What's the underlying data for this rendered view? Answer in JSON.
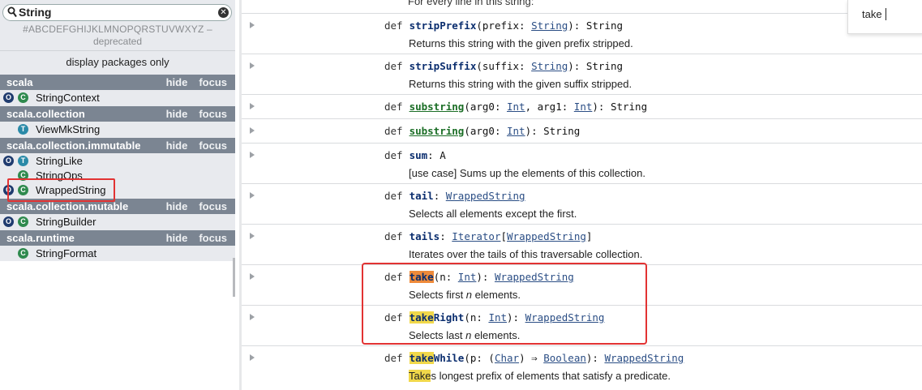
{
  "sidebar": {
    "search_value": "String",
    "letters": "#ABCDEFGHIJKLMNOPQRSTUVWXYZ –",
    "deprecated": "deprecated",
    "display_packages": "display packages only",
    "hide_label": "hide",
    "focus_label": "focus",
    "packages": [
      {
        "name": "scala",
        "entries": [
          {
            "label": "StringContext",
            "icons": [
              "object-icon",
              "class-icon"
            ]
          }
        ]
      },
      {
        "name": "scala.collection",
        "entries": [
          {
            "label": "ViewMkString",
            "icons": [
              "trait-icon"
            ]
          }
        ]
      },
      {
        "name": "scala.collection.immutable",
        "entries": [
          {
            "label": "StringLike",
            "icons": [
              "object-icon",
              "trait-icon"
            ]
          },
          {
            "label": "StringOps",
            "icons": [
              "class-icon"
            ]
          },
          {
            "label": "WrappedString",
            "icons": [
              "object-icon",
              "class-icon"
            ]
          }
        ]
      },
      {
        "name": "scala.collection.mutable",
        "entries": [
          {
            "label": "StringBuilder",
            "icons": [
              "object-icon",
              "class-icon"
            ]
          }
        ]
      },
      {
        "name": "scala.runtime",
        "entries": [
          {
            "label": "StringFormat",
            "icons": [
              "class-icon"
            ]
          }
        ]
      }
    ]
  },
  "main": {
    "first_line": "For every line in this string:",
    "find_value": "take",
    "members": [
      {
        "kw": "def",
        "name": "stripPrefix",
        "p1": "(prefix: ",
        "t1": "String",
        "p2": "): String",
        "desc": "Returns this string with the given prefix stripped."
      },
      {
        "kw": "def",
        "name": "stripSuffix",
        "p1": "(suffix: ",
        "t1": "String",
        "p2": "): String",
        "desc": "Returns this string with the given suffix stripped."
      },
      {
        "kw": "def",
        "name": "substring",
        "p1": "(arg0: ",
        "t1": "Int",
        "p2": ", arg1: ",
        "t2": "Int",
        "p3": "): String"
      },
      {
        "kw": "def",
        "name": "substring",
        "p1": "(arg0: ",
        "t1": "Int",
        "p2": "): String"
      },
      {
        "kw": "def",
        "name": "sum",
        "p1": ": A",
        "desc": "[use case] Sums up the elements of this collection."
      },
      {
        "kw": "def",
        "name": "tail",
        "p1": ": ",
        "t1": "WrappedString",
        "desc": "Selects all elements except the first."
      },
      {
        "kw": "def",
        "name": "tails",
        "p1": ": ",
        "t1": "Iterator",
        "p2": "[",
        "t2": "WrappedString",
        "p3": "]",
        "desc": "Iterates over the tails of this traversable collection."
      },
      {
        "kw": "def",
        "name_hl": "take",
        "p1": "(n: ",
        "t1": "Int",
        "p2": "): ",
        "t2": "WrappedString",
        "desc_a": "Selects first ",
        "desc_n": "n",
        "desc_b": " elements."
      },
      {
        "kw": "def",
        "name_hl": "take",
        "name_rest": "Right",
        "p1": "(n: ",
        "t1": "Int",
        "p2": "): ",
        "t2": "WrappedString",
        "desc_a": "Selects last ",
        "desc_n": "n",
        "desc_b": " elements."
      },
      {
        "kw": "def",
        "name_hl": "take",
        "name_rest": "While",
        "p1": "(p: (",
        "t1": "Char",
        "p2": ") ⇒ ",
        "t2": "Boolean",
        "p3": "): ",
        "t3": "WrappedString",
        "desc_hl": "Take",
        "desc_b": "s longest prefix of elements that satisfy a predicate."
      }
    ]
  }
}
